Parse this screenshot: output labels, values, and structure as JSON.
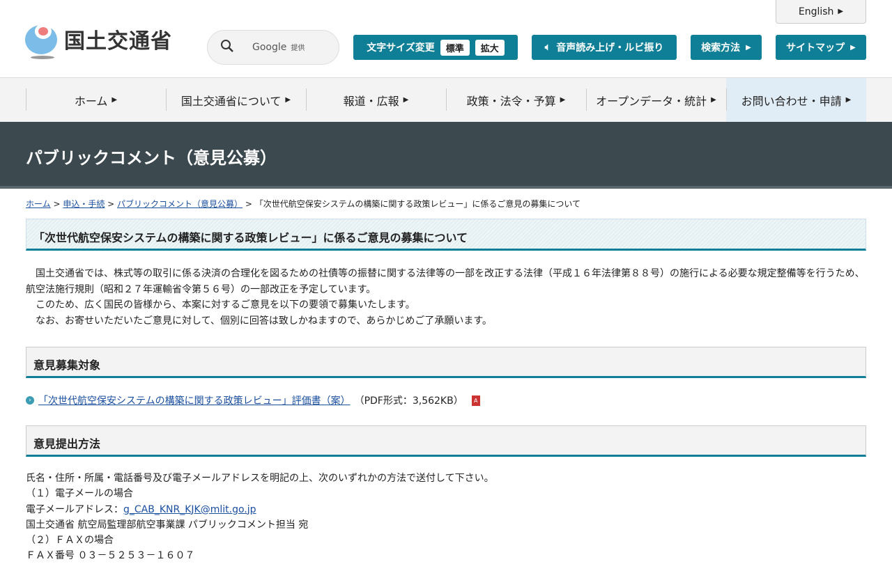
{
  "header": {
    "logo_text": "国土交通省",
    "search_brand": "Google",
    "search_provided": "提供",
    "english": "English",
    "font_size_label": "文字サイズ変更",
    "font_standard": "標準",
    "font_large": "拡大",
    "speech": "音声読み上げ・ルビ振り",
    "search_method": "検索方法",
    "sitemap": "サイトマップ"
  },
  "nav": [
    {
      "label": "ホーム"
    },
    {
      "label": "国土交通省について"
    },
    {
      "label": "報道・広報"
    },
    {
      "label": "政策・法令・予算"
    },
    {
      "label": "オープンデータ・統計"
    },
    {
      "label": "お問い合わせ・申請"
    }
  ],
  "banner": "パブリックコメント（意見公募）",
  "breadcrumb": {
    "home": "ホーム",
    "apply": "申込・手続",
    "pubcom": "パブリックコメント（意見公募）",
    "current": "「次世代航空保安システムの構築に関する政策レビュー」に係るご意見の募集について"
  },
  "title": "「次世代航空保安システムの構築に関する政策レビュー」に係るご意見の募集について",
  "intro": [
    "　国土交通省では、株式等の取引に係る決済の合理化を図るための社債等の振替に関する法律等の一部を改正する法律（平成１６年法律第８８号）の施行による必要な規定整備等を行うため、航空法施行規則（昭和２７年運輸省令第５６号）の一部改正を予定しています。",
    "　このため、広く国民の皆様から、本案に対するご意見を以下の要領で募集いたします。",
    "　なお、お寄せいただいたご意見に対して、個別に回答は致しかねますので、あらかじめご了承願います。"
  ],
  "section1": {
    "heading": "意見募集対象",
    "link": "「次世代航空保安システムの構築に関する政策レビュー」評価書（案）",
    "file_info": "（PDF形式：3,562KB）"
  },
  "section2": {
    "heading": "意見提出方法",
    "line1": "氏名・住所・所属・電話番号及び電子メールアドレスを明記の上、次のいずれかの方法で送付して下さい。",
    "email_case": "（１）電子メールの場合",
    "email_label": "電子メールアドレス：",
    "email": "g_CAB_KNR_KJK@mlit.go.jp",
    "addressee": "国土交通省 航空局監理部航空事業課 パブリックコメント担当 宛",
    "fax_case": "（２）ＦＡＸの場合",
    "fax": "ＦＡＸ番号 ０３－５２５３－１６０７"
  }
}
